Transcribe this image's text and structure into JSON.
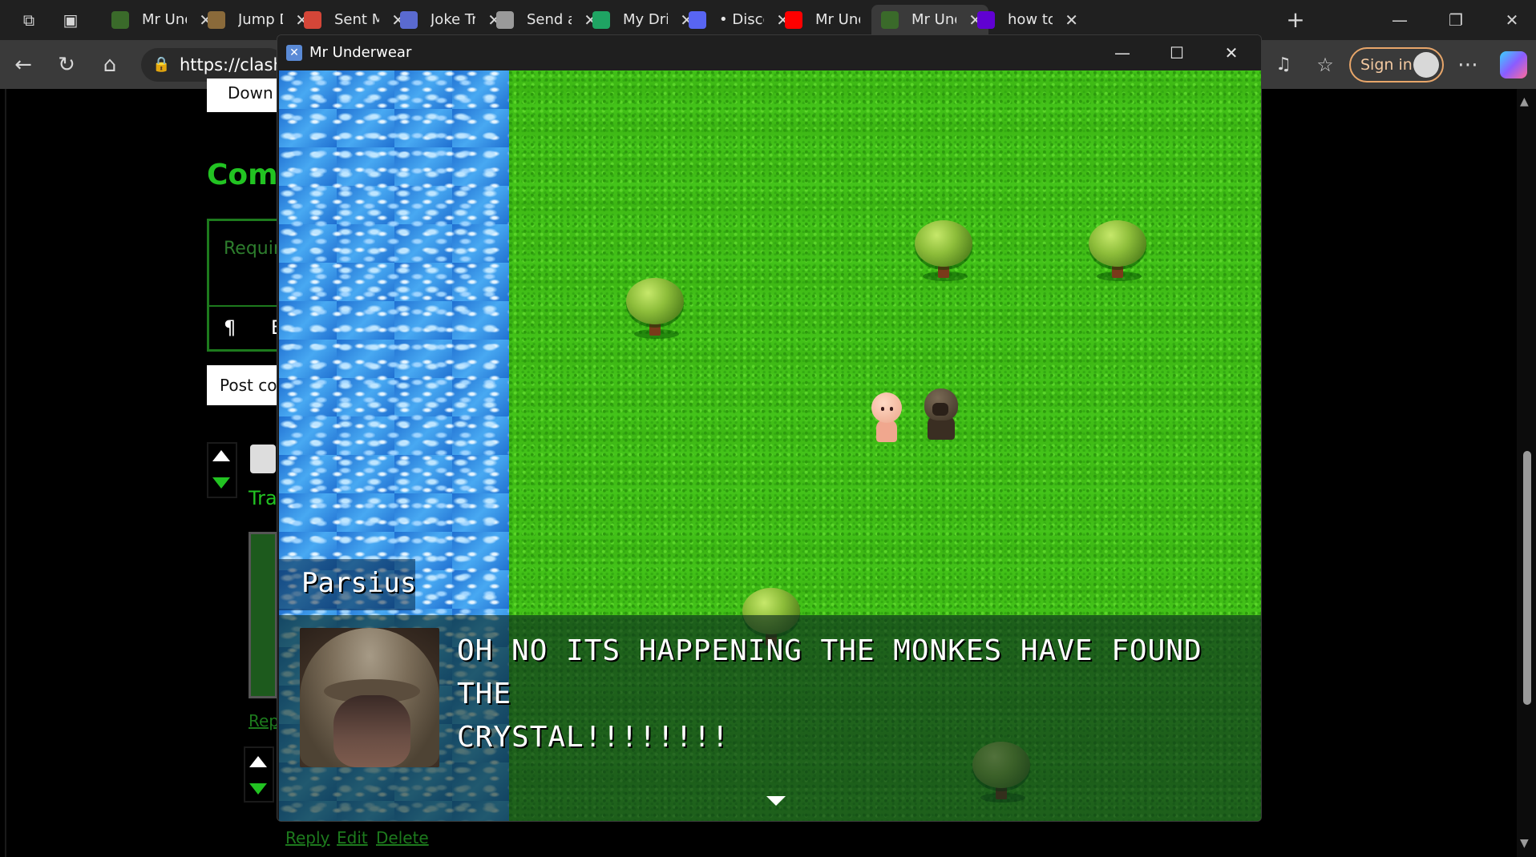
{
  "browser": {
    "tabs": [
      {
        "title": "Mr Und",
        "favicon_color": "#3a6a2a"
      },
      {
        "title": "Jump D",
        "favicon_color": "#8a6a3a"
      },
      {
        "title": "Sent M",
        "favicon_color": "#d44638"
      },
      {
        "title": "Joke Tr",
        "favicon_color": "#5a6ad0"
      },
      {
        "title": "Send a",
        "favicon_color": "#9a9a9a"
      },
      {
        "title": "My Dri",
        "favicon_color": "#1fa463"
      },
      {
        "title": "• Disco",
        "favicon_color": "#5865f2"
      },
      {
        "title": "Mr Und",
        "favicon_color": "#ff0000"
      },
      {
        "title": "Mr Und",
        "favicon_color": "#3a6a2a"
      },
      {
        "title": "how to",
        "favicon_color": "#6001d2"
      }
    ],
    "active_tab_index": 8,
    "address": "https://clashr",
    "sign_in_label": "Sign in"
  },
  "page": {
    "download_label": "Down",
    "comments_heading": "Comm",
    "comment_placeholder": "Requir",
    "format_pilcrow": "¶",
    "format_bold": "B",
    "post_label": "Post co",
    "comment_text_fragment": "Tra",
    "reply_link": "Rep",
    "links": {
      "reply": "Reply",
      "edit": "Edit",
      "delete": "Delete"
    }
  },
  "game_window": {
    "title": "Mr Underwear",
    "speaker": "Parsius",
    "message_line1": "OH NO ITS HAPPENING THE MONKES HAVE FOUND THE",
    "message_line2": "CRYSTAL!!!!!!!!"
  },
  "colors": {
    "accent_green": "#22c322",
    "dark_green": "#1d7a1d",
    "sign_in_border": "#e8a66a"
  }
}
